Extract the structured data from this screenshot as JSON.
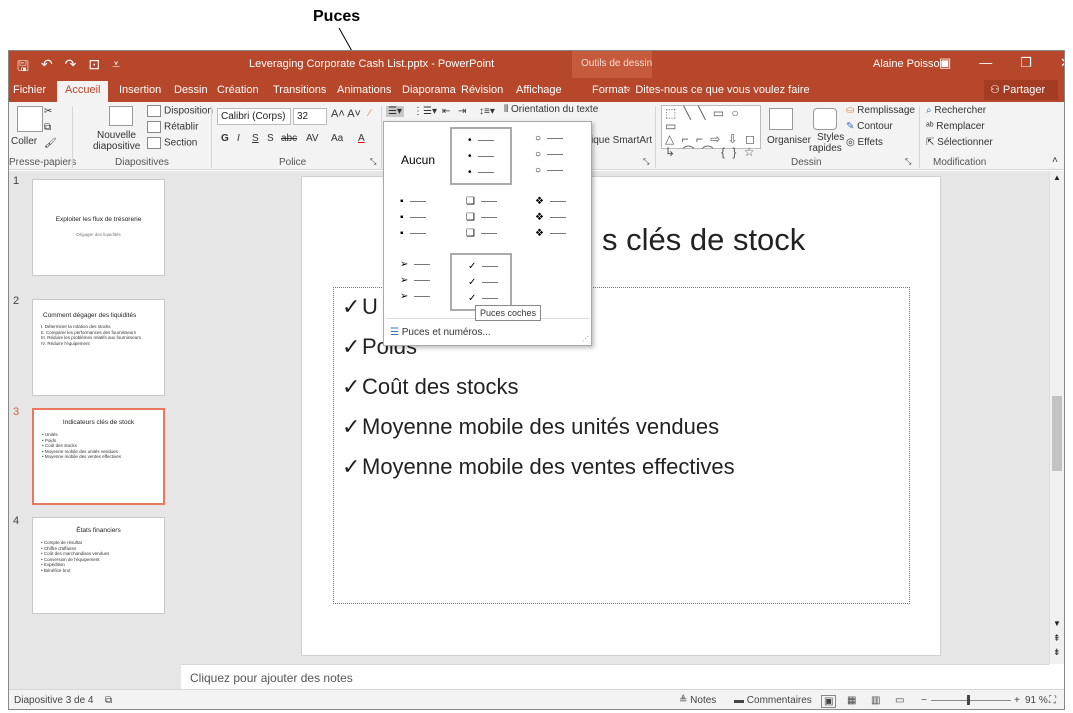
{
  "callout": {
    "label": "Puces"
  },
  "titlebar": {
    "doc_title": "Leveraging Corporate Cash List.pptx - PowerPoint",
    "context_title": "Outils de dessin",
    "user": "Alaine Poisson",
    "accent": "#b7472a"
  },
  "tabs": {
    "file": "Fichier",
    "home": "Accueil",
    "insert": "Insertion",
    "draw": "Dessin",
    "design": "Création",
    "transitions": "Transitions",
    "animations": "Animations",
    "slideshow": "Diaporama",
    "review": "Révision",
    "view": "Affichage",
    "format": "Format",
    "tell_me": "Dites-nous ce que vous voulez faire",
    "share": "Partager"
  },
  "ribbon": {
    "clipboard": {
      "paste": "Coller",
      "label": "Presse-papiers"
    },
    "slides": {
      "new_slide_1": "Nouvelle",
      "new_slide_2": "diapositive",
      "layout": "Disposition",
      "reset": "Rétablir",
      "section": "Section",
      "label": "Diapositives"
    },
    "font": {
      "name": "Calibri (Corps)",
      "size": "32",
      "label": "Police",
      "bold": "G",
      "italic": "I",
      "underline": "S",
      "shadow": "S",
      "strike": "abc",
      "case": "Aa"
    },
    "paragraph": {
      "text_direction": "Orientation du texte",
      "smartart": "ique SmartArt"
    },
    "drawing": {
      "shapes": "⬚ ╲ ╲ ▭ ○ ▭",
      "shapes2": "△ ⌐ ⌐ ⇨ ⇩ ◻",
      "shapes3": "↳ ⌒ ⌒ { } ☆",
      "arrange": "Organiser",
      "styles_1": "Styles",
      "styles_2": "rapides",
      "fill": "Remplissage",
      "outline": "Contour",
      "effects": "Effets",
      "label": "Dessin"
    },
    "editing": {
      "find": "Rechercher",
      "replace": "Remplacer",
      "select": "Sélectionner",
      "label": "Modification"
    }
  },
  "thumbnails": [
    {
      "num": "1",
      "title": "Exploiter les flux de trésorerie",
      "subtitle": "Dégager des liquidités",
      "bullets": []
    },
    {
      "num": "2",
      "title": "Comment dégager des liquidités",
      "subtitle": "",
      "bullets": [
        "I.   Déterminer la rotation des stocks",
        "II.  Comparer les performances des fournisseurs",
        "III. Réduire les problèmes relatifs aux fournisseurs",
        "IV.  Réduire l'équipement"
      ]
    },
    {
      "num": "3",
      "title": "Indicateurs clés de stock",
      "subtitle": "",
      "bullets": [
        "• Unités",
        "• Poids",
        "• Coût des stocks",
        "• Moyenne mobile des unités vendues",
        "• Moyenne mobile des ventes effectives"
      ]
    },
    {
      "num": "4",
      "title": "États financiers",
      "subtitle": "",
      "bullets": [
        "• Compte de résultat",
        "• Chiffre d'affaires",
        "• Coût des marchandises vendues",
        "• Conversion de l'équipement",
        "• Expédition",
        "• Bénéfice brut"
      ]
    }
  ],
  "slide": {
    "title_visible": "s clés de stock",
    "bullet_glyph": "✓",
    "bullets": [
      "U",
      "Poids",
      "Coût des stocks",
      "Moyenne mobile des unités vendues",
      "Moyenne mobile des ventes effectives"
    ]
  },
  "notes_placeholder": "Cliquez pour ajouter des notes",
  "status": {
    "slide_info": "Diapositive 3 de 4",
    "notes": "Notes",
    "comments": "Commentaires",
    "zoom": "91 %"
  },
  "dropdown": {
    "none": "Aucun",
    "small_dot": "•",
    "hollow": "○",
    "filled_square": "▪",
    "hollow_square": "❑",
    "diamonds": "❖",
    "arrow": "➢",
    "check": "✓",
    "footer": "Puces et numéros...",
    "tooltip": "Puces coches"
  }
}
